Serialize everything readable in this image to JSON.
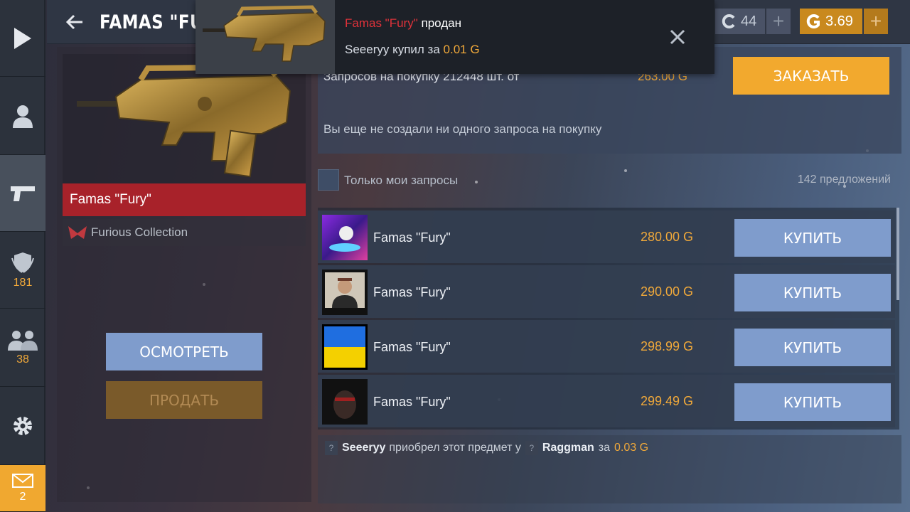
{
  "header": {
    "title": "FAMAS \"FURY\"",
    "silver_amount": "44",
    "gold_amount": "3.69"
  },
  "sidebar": {
    "rank_count": "181",
    "friends_count": "38",
    "mail_count": "2"
  },
  "item": {
    "name": "Famas \"Fury\"",
    "collection": "Furious Collection",
    "inspect_label": "ОСМОТРЕТЬ",
    "sell_label": "ПРОДАТЬ"
  },
  "requests": {
    "summary": "Запросов на покупку 212448 шт. от",
    "price": "263.00 G",
    "empty_text": "Вы еще не создали ни одного запроса на покупку",
    "order_label": "ЗАКАЗАТЬ"
  },
  "filter": {
    "only_mine_label": "Только мои запросы",
    "offer_count": "142 предложений"
  },
  "listings": [
    {
      "name": "Famas \"Fury\"",
      "price": "280.00 G",
      "buy_label": "КУПИТЬ"
    },
    {
      "name": "Famas \"Fury\"",
      "price": "290.00 G",
      "buy_label": "КУПИТЬ"
    },
    {
      "name": "Famas \"Fury\"",
      "price": "298.99 G",
      "buy_label": "КУПИТЬ"
    },
    {
      "name": "Famas \"Fury\"",
      "price": "299.49 G",
      "buy_label": "КУПИТЬ"
    }
  ],
  "history": {
    "buyer": "Seeeryy",
    "action": "приобрел этот предмет у",
    "seller": "Raggman",
    "for_word": "за",
    "price": "0.03 G"
  },
  "toast": {
    "item_name": "Famas \"Fury\"",
    "sold_word": "продан",
    "buyer_text": "Seeeryy купил за",
    "price": "0.01 G"
  },
  "colors": {
    "accent_gold": "#f1a93a",
    "button_blue": "#7f9ccc",
    "item_red": "#a8222a"
  }
}
